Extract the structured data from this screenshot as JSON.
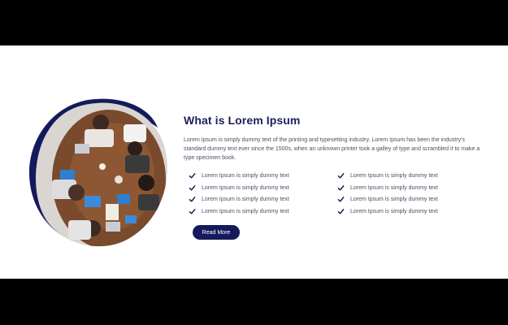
{
  "section": {
    "title": "What is Lorem Ipsum",
    "description": "Lorem Ipsum is simply dummy text of the printing and typesetting industry. Lorem Ipsum has been the industry's standard dummy text ever since the 1500s, when an unknown printer took a galley of type and scrambled it to make a type specimen book.",
    "features_left": [
      "Lorem Ipsum is simply dummy text",
      "Lorem Ipsum is simply dummy text",
      "Lorem Ipsum is simply dummy text",
      "Lorem Ipsum is simply dummy text"
    ],
    "features_right": [
      "Lorem Ipsum is simply dummy text",
      "Lorem Ipsum is simply dummy text",
      "Lorem Ipsum is simply dummy text",
      "Lorem Ipsum is simply dummy text"
    ],
    "button_label": "Read More"
  },
  "icons": {
    "feature_check": "check-icon"
  },
  "colors": {
    "accent": "#141a5b",
    "title": "#1b1f5c",
    "body_text": "#4b4f63",
    "letterbox": "#000000",
    "background": "#ffffff"
  }
}
